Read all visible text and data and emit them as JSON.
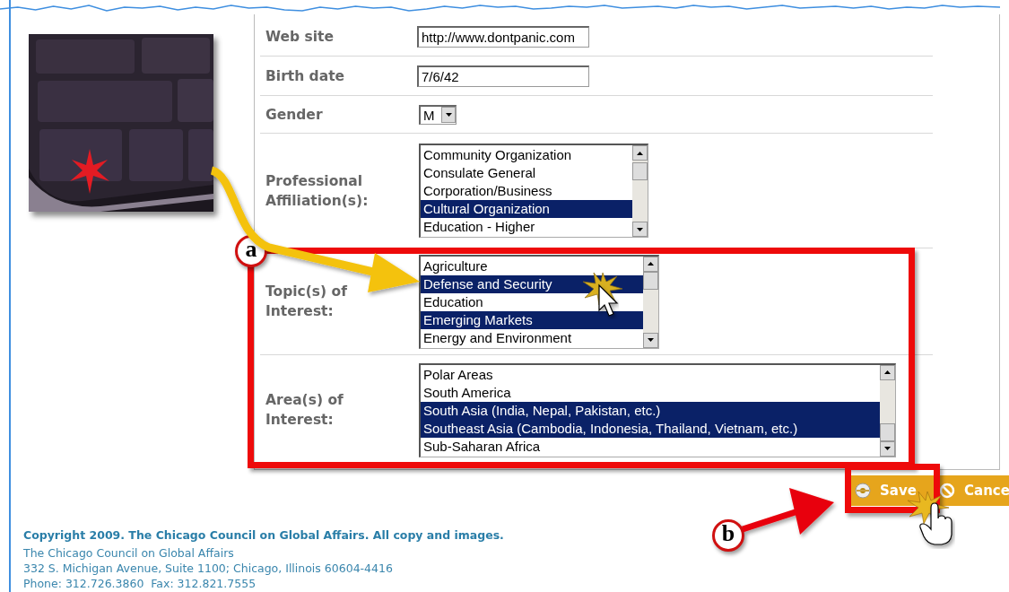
{
  "form": {
    "fields": [
      {
        "kind": "text",
        "label": "Web site",
        "value": "http://www.dontpanic.com"
      },
      {
        "kind": "text",
        "label": "Birth date",
        "value": "7/6/42"
      },
      {
        "kind": "select",
        "label": "Gender",
        "value": "M"
      },
      {
        "kind": "listbox",
        "label": "Professional Affiliation(s):",
        "options": [
          {
            "text": "Community Organization",
            "selected": false
          },
          {
            "text": "Consulate General",
            "selected": false
          },
          {
            "text": "Corporation/Business",
            "selected": false
          },
          {
            "text": "Cultural Organization",
            "selected": true
          },
          {
            "text": "Education - Higher",
            "selected": false
          }
        ]
      },
      {
        "kind": "listbox",
        "label": "Topic(s) of Interest:",
        "options": [
          {
            "text": "Agriculture",
            "selected": false
          },
          {
            "text": "Defense and Security",
            "selected": true
          },
          {
            "text": "Education",
            "selected": false
          },
          {
            "text": "Emerging Markets",
            "selected": true
          },
          {
            "text": "Energy and Environment",
            "selected": false
          }
        ]
      },
      {
        "kind": "listbox",
        "label": "Area(s) of Interest:",
        "options": [
          {
            "text": "Polar Areas",
            "selected": false
          },
          {
            "text": "South America",
            "selected": false
          },
          {
            "text": "South Asia (India, Nepal, Pakistan, etc.)",
            "selected": true
          },
          {
            "text": "Southeast Asia (Cambodia, Indonesia, Thailand, Vietnam, etc.)",
            "selected": true
          },
          {
            "text": "Sub-Saharan Africa",
            "selected": false
          }
        ]
      }
    ]
  },
  "buttons": [
    {
      "kind": "save",
      "label": "Save"
    },
    {
      "kind": "cancel",
      "label": "Cance"
    }
  ],
  "callouts": [
    {
      "label": "a"
    },
    {
      "label": "b"
    }
  ],
  "footer": {
    "copyright": "Copyright 2009. The Chicago Council on Global Affairs. All copy and images.",
    "lines": [
      "The Chicago Council on Global Affairs",
      "332 S. Michigan Avenue, Suite 1100; Chicago, Illinois 60604-4416",
      "Phone: 312.726.3860  Fax: 312.821.7555"
    ]
  }
}
